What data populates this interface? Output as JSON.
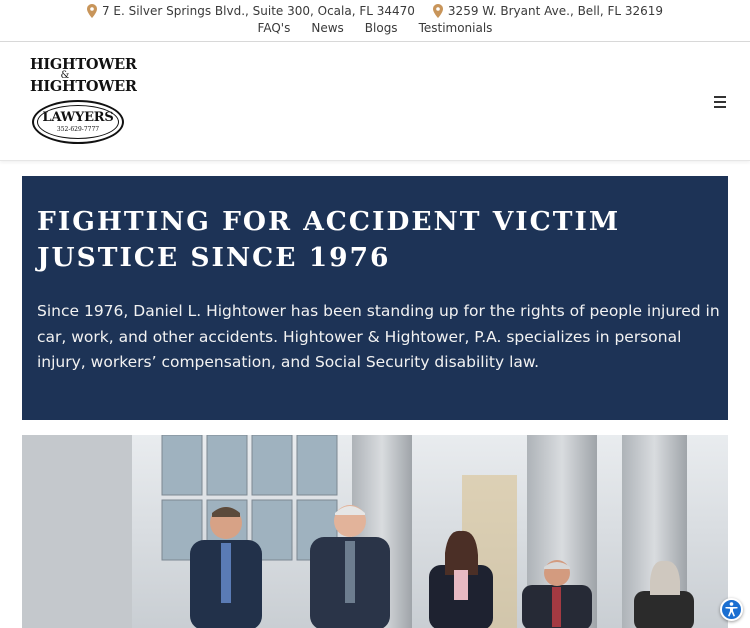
{
  "topbar": {
    "addresses": [
      {
        "text": "7 E. Silver Springs Blvd., Suite 300, Ocala, FL 34470",
        "icon": "map-pin-icon"
      },
      {
        "text": "3259 W. Bryant Ave., Bell, FL 32619",
        "icon": "map-pin-icon"
      }
    ],
    "links": [
      "FAQ's",
      "News",
      "Blogs",
      "Testimonials"
    ],
    "pin_color": "#c8955a"
  },
  "logo": {
    "line1": "Hightower",
    "amp": "&",
    "line2": "Hightower",
    "badge": "LAWYERS",
    "phone": "352-629-7777"
  },
  "header": {
    "menu_icon": "hamburger-menu-icon"
  },
  "hero": {
    "title": "Fighting for Accident Victim Justice Since 1976",
    "body": "Since 1976, Daniel L. Hightower has been standing up for the rights of people injured in car, work, and other accidents. Hightower & Hightower, P.A. specializes in personal injury, workers’ compensation, and Social Security disability law.",
    "background": "#1d3356"
  },
  "team_photo": {
    "people_count": 5
  },
  "accessibility": {
    "icon": "accessibility-icon",
    "color": "#1b6fd1"
  }
}
